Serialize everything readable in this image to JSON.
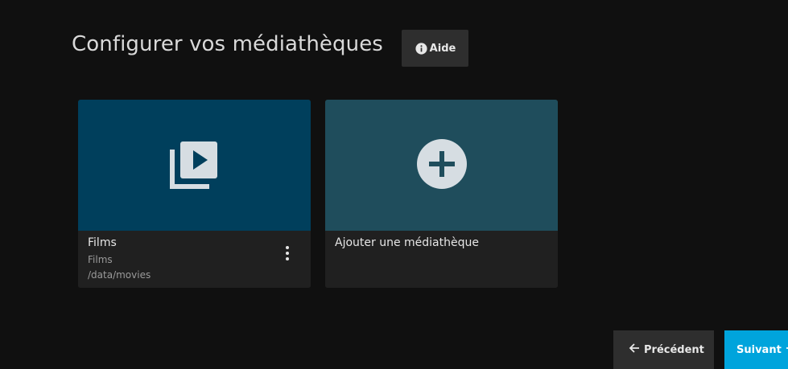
{
  "header": {
    "title": "Configurer vos médiathèques",
    "help_label": "Aide"
  },
  "libraries": [
    {
      "name": "Films",
      "type": "Films",
      "path": "/data/movies",
      "icon": "video-library-icon",
      "color": "#003f5c"
    }
  ],
  "add_library": {
    "label": "Ajouter une médiathèque",
    "icon": "add-circle-icon",
    "color": "#1f4d5c"
  },
  "footer": {
    "previous_label": "Précédent",
    "next_label": "Suivant"
  },
  "colors": {
    "background": "#101010",
    "accent": "#00a4dc",
    "card_footer": "#202020"
  }
}
